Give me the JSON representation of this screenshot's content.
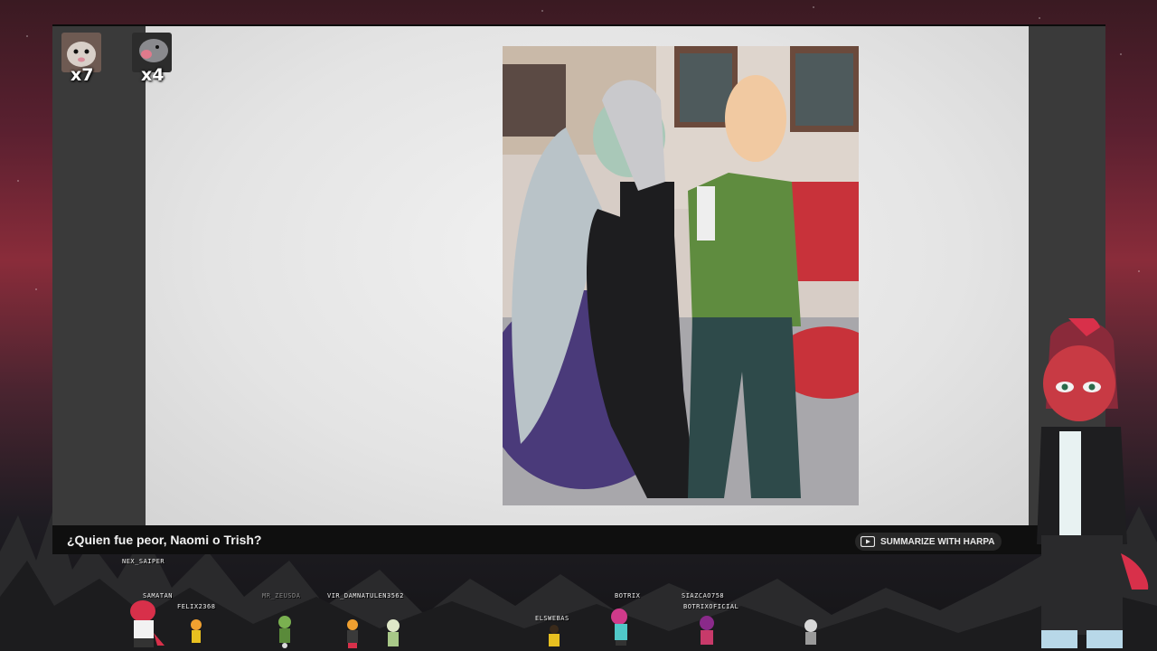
{
  "video": {
    "title": "¿Quien fue peor, Naomi o Trish?",
    "summarize_label": "SUMMARIZE WITH HARPA"
  },
  "counters": [
    {
      "icon": "opossum-icon",
      "label": "x7"
    },
    {
      "icon": "opossum-screaming-icon",
      "label": "x4"
    }
  ],
  "chatters": [
    {
      "name": "NEX_SAIPER",
      "dim": false
    },
    {
      "name": "SAMATAN",
      "dim": false
    },
    {
      "name": "FELIX2368",
      "dim": false
    },
    {
      "name": "MR_ZEUSDA",
      "dim": true
    },
    {
      "name": "VIR_DAMNATULEN3562",
      "dim": false
    },
    {
      "name": "ELSWEBAS",
      "dim": false
    },
    {
      "name": "BOTRIX",
      "dim": false
    },
    {
      "name": "SIAZCAO758",
      "dim": false
    },
    {
      "name": "BOTRIXOFICIAL",
      "dim": false
    }
  ],
  "colors": {
    "accent_red": "#d8304a",
    "player_bg": "#0f0f0f",
    "stage_bg": "#e8e8e8"
  }
}
